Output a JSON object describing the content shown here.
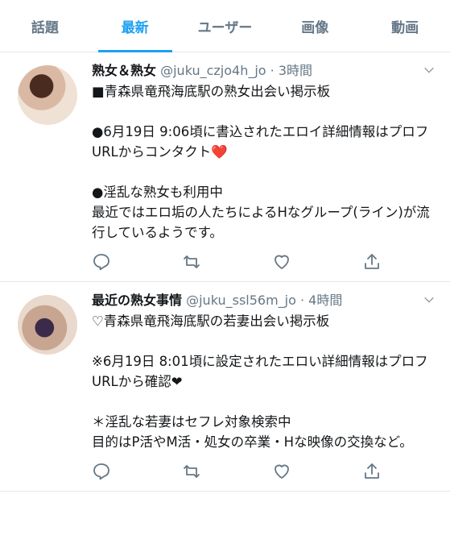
{
  "tabs": [
    "話題",
    "最新",
    "ユーザー",
    "画像",
    "動画"
  ],
  "active_tab": 1,
  "tweets": [
    {
      "name": "熟女＆熟女",
      "handle": "@juku_czjo4h_jo",
      "time": "3時間",
      "text": "■青森県竜飛海底駅の熟女出会い掲示板\n\n●6月19日 9:06頃に書込されたエロイ詳細情報はプロフURLからコンタクト❤️\n\n●淫乱な熟女も利用中\n最近ではエロ垢の人たちによるHなグループ(ライン)が流行しているようです。"
    },
    {
      "name": "最近の熟女事情",
      "handle": "@juku_ssl56m_jo",
      "time": "4時間",
      "text": "♡青森県竜飛海底駅の若妻出会い掲示板\n\n※6月19日 8:01頃に設定されたエロい詳細情報はプロフURLから確認❤\n\n＊淫乱な若妻はセフレ対象検索中\n目的はP活やM活・処女の卒業・Hな映像の交換など。"
    }
  ],
  "colors": {
    "accent": "#1da1f2",
    "secondary": "#657786",
    "divider": "#e1e8ed"
  },
  "icons": [
    "reply-icon",
    "retweet-icon",
    "like-icon",
    "share-icon",
    "chevron-down-icon"
  ]
}
